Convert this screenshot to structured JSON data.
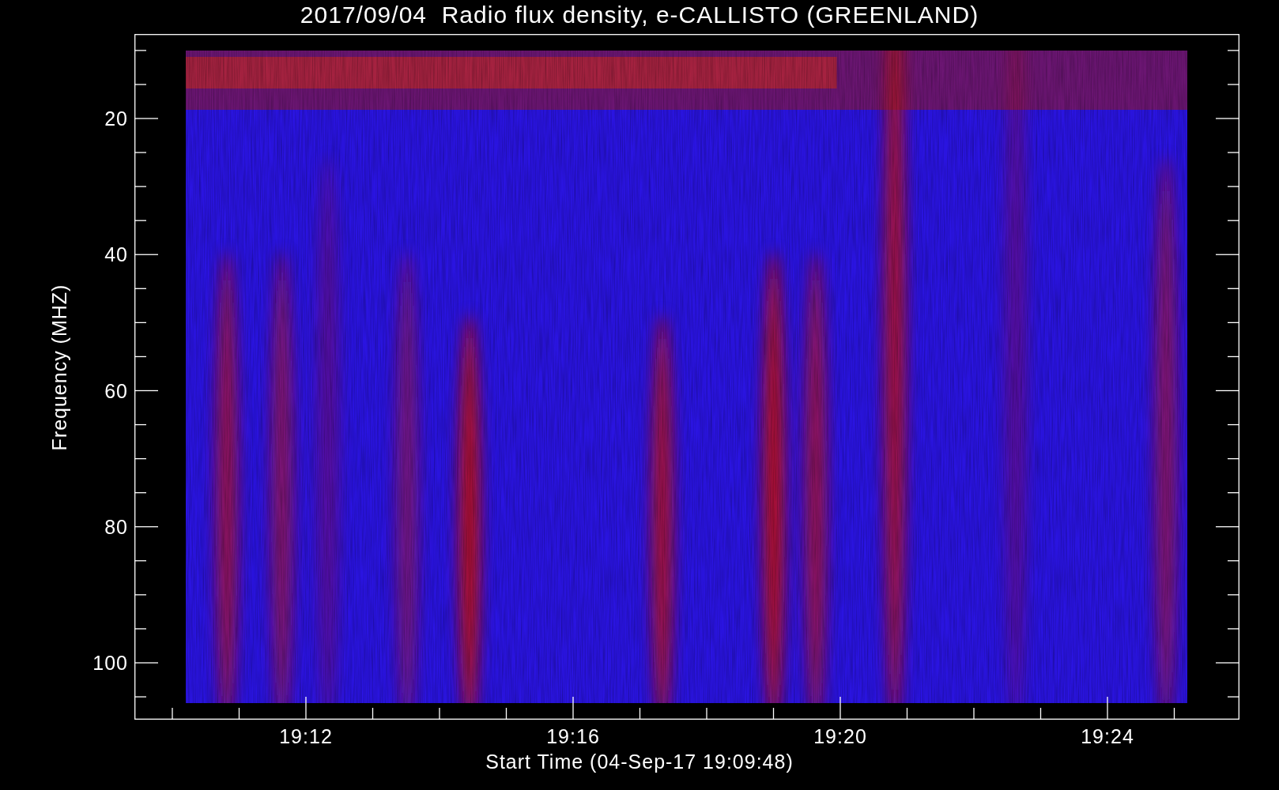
{
  "title": "2017/09/04  Radio flux density, e-CALLISTO (GREENLAND)",
  "y_axis": {
    "label": "Frequency (MHZ)",
    "ticks": [
      "20",
      "40",
      "60",
      "80",
      "100"
    ]
  },
  "x_axis": {
    "label": "Start Time (04-Sep-17 19:09:48)",
    "ticks": [
      "19:12",
      "19:16",
      "19:20",
      "19:24"
    ]
  }
}
